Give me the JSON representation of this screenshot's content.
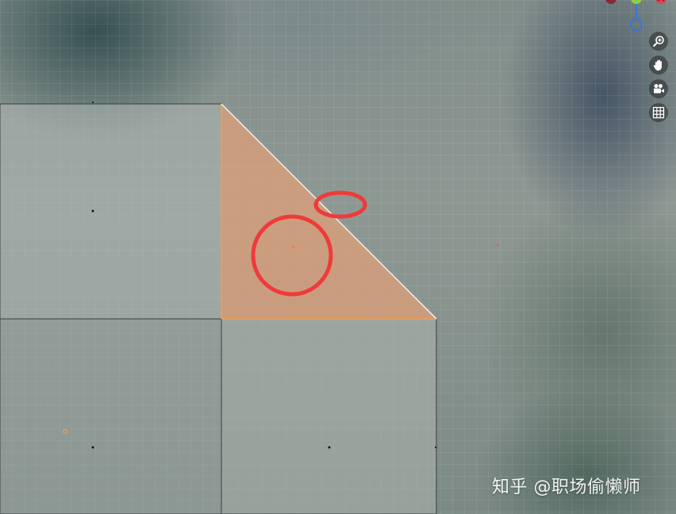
{
  "viewport": {
    "gizmo_axes": [
      "x-negative",
      "y-positive",
      "x-positive",
      "z-negative"
    ],
    "axis_colors": {
      "x": "#e04454",
      "y": "#8cd23a",
      "z": "#3a74d8"
    },
    "selection_color": "#f0a050",
    "face_fill_color": "#d8a58a",
    "annotation_color": "#f03a3a",
    "tools": [
      {
        "name": "zoom",
        "icon": "magnifier-plus-icon"
      },
      {
        "name": "pan",
        "icon": "hand-icon"
      },
      {
        "name": "camera",
        "icon": "camera-icon"
      },
      {
        "name": "perspective",
        "icon": "grid-icon"
      }
    ]
  },
  "watermark": {
    "text": "知乎 @职场偷懒师"
  }
}
